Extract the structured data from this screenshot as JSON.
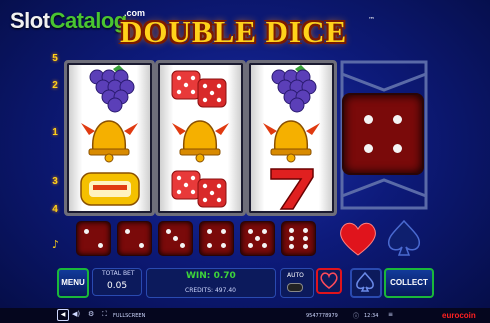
{
  "watermark": {
    "part1": "Slot",
    "part2": "Catalog",
    "suffix": ".com"
  },
  "game_title": "DOUBLE DICE",
  "title_mark": "™",
  "paylines": {
    "five": "5",
    "two": "2",
    "one": "1",
    "three": "3",
    "four": "4"
  },
  "reels": [
    [
      "grapes-icon",
      "bell-icon",
      "bar-icon"
    ],
    [
      "dice-icon",
      "bell-icon",
      "dice-icon"
    ],
    [
      "grapes-icon",
      "bell-icon",
      "seven-icon"
    ]
  ],
  "big_die_value": 4,
  "small_dice_values": [
    2,
    2,
    3,
    4,
    5,
    6
  ],
  "controls": {
    "menu_label": "MENU",
    "total_bet_label": "TOTAL BET",
    "total_bet_value": "0.05",
    "win_label": "WIN:",
    "win_value": "0.70",
    "credits_label": "CREDITS:",
    "credits_value": "497.40",
    "auto_label": "AUTO",
    "collect_label": "COLLECT"
  },
  "status": {
    "fullscreen_label": "FULLSCREEN",
    "ticket_id": "9547778979",
    "time": "12:34",
    "brand": "eurocoin"
  },
  "colors": {
    "accent": "#1ab83a",
    "win": "#3ed43a",
    "title": "#ffd21a",
    "dice": "#7a0a0a"
  }
}
